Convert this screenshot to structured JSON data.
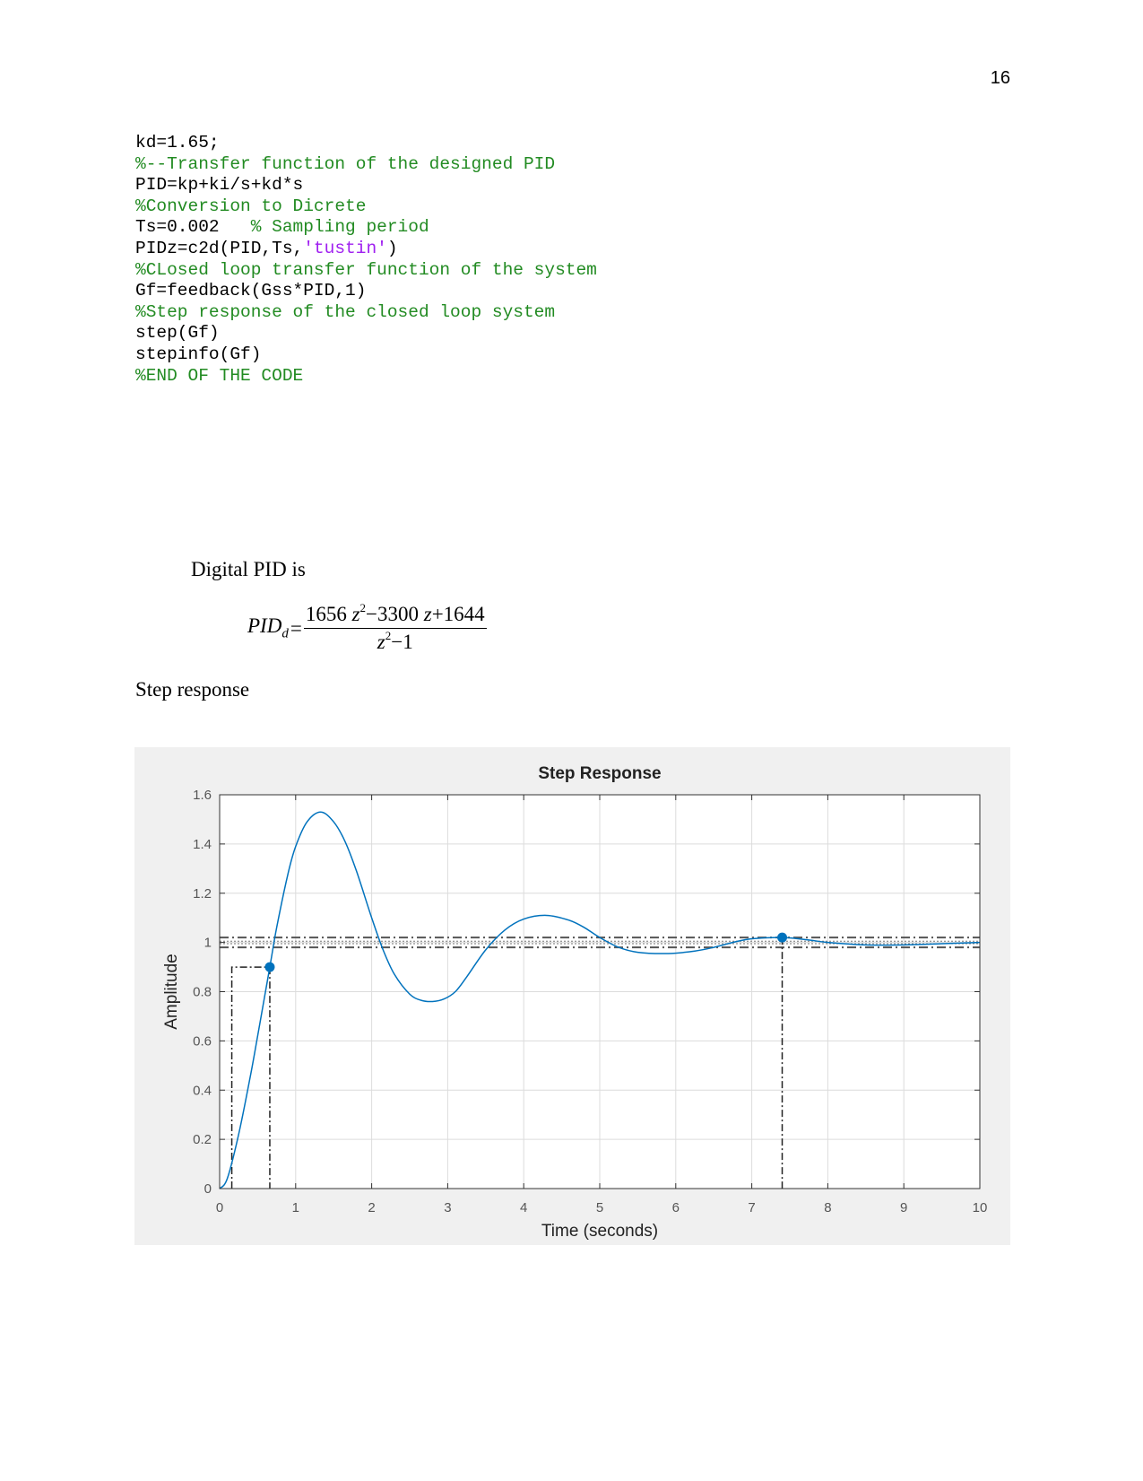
{
  "page_number": "16",
  "code_lines": [
    [
      {
        "t": "kd=1.65;",
        "k": "code"
      }
    ],
    [
      {
        "t": "%--Transfer function of the designed PID",
        "k": "comment"
      }
    ],
    [
      {
        "t": "PID=kp+ki/s+kd*s",
        "k": "code"
      }
    ],
    [
      {
        "t": "%Conversion to Dicrete",
        "k": "comment"
      }
    ],
    [
      {
        "t": "Ts=0.002   ",
        "k": "code"
      },
      {
        "t": "% Sampling period",
        "k": "comment"
      }
    ],
    [
      {
        "t": "PIDz=c2d(PID,Ts,",
        "k": "code"
      },
      {
        "t": "'tustin'",
        "k": "string"
      },
      {
        "t": ")",
        "k": "code"
      }
    ],
    [
      {
        "t": "%CLosed loop transfer function of the system",
        "k": "comment"
      }
    ],
    [
      {
        "t": "Gf=feedback(Gss*PID,1)",
        "k": "code"
      }
    ],
    [
      {
        "t": "%Step response of the closed loop system",
        "k": "comment"
      }
    ],
    [
      {
        "t": "step(Gf)",
        "k": "code"
      }
    ],
    [
      {
        "t": "stepinfo(Gf)",
        "k": "code"
      }
    ],
    [
      {
        "t": "%END OF THE CODE",
        "k": "comment"
      }
    ]
  ],
  "colors": {
    "comment": "#228b22",
    "string": "#a020f0",
    "code": "#000000",
    "curve": "#0072bd",
    "chart_bg": "#f0f0f0"
  },
  "digital_pid_label": "Digital PID is",
  "equation": {
    "lhs": "PID",
    "lhs_sub": "d",
    "equals": "=",
    "num_a": "1656",
    "num_b": "−3300",
    "num_c": "+1644",
    "den_b": "−1",
    "var": "z",
    "exp": "2"
  },
  "step_response_label": "Step response",
  "chart_data": {
    "type": "line",
    "title": "Step Response",
    "xlabel": "Time (seconds)",
    "ylabel": "Amplitude",
    "xlim": [
      0,
      10
    ],
    "ylim": [
      0,
      1.6
    ],
    "xticks": [
      "0",
      "1",
      "2",
      "3",
      "4",
      "5",
      "6",
      "7",
      "8",
      "9",
      "10"
    ],
    "yticks": [
      "0",
      "0.2",
      "0.4",
      "0.6",
      "0.8",
      "1",
      "1.2",
      "1.4",
      "1.6"
    ],
    "grid": true,
    "x": [
      0,
      0.1,
      0.25,
      0.4,
      0.5,
      0.66,
      0.75,
      0.9,
      1.0,
      1.15,
      1.33,
      1.5,
      1.65,
      1.8,
      2.0,
      2.15,
      2.3,
      2.5,
      2.65,
      2.8,
      2.95,
      3.1,
      3.25,
      3.5,
      3.75,
      4.0,
      4.3,
      4.6,
      4.8,
      5.0,
      5.25,
      5.5,
      5.9,
      6.25,
      6.5,
      6.75,
      7.0,
      7.4,
      7.75,
      8.0,
      8.5,
      9.0,
      9.5,
      10
    ],
    "y": [
      0,
      0.04,
      0.22,
      0.45,
      0.62,
      0.9,
      1.06,
      1.28,
      1.39,
      1.49,
      1.53,
      1.49,
      1.41,
      1.29,
      1.1,
      0.97,
      0.87,
      0.79,
      0.765,
      0.76,
      0.77,
      0.8,
      0.86,
      0.97,
      1.05,
      1.095,
      1.11,
      1.09,
      1.06,
      1.02,
      0.98,
      0.96,
      0.955,
      0.965,
      0.98,
      1.0,
      1.015,
      1.02,
      1.01,
      1.0,
      0.99,
      0.99,
      0.995,
      1.0
    ],
    "markers": [
      {
        "label": "rise time",
        "x": 0.66,
        "y": 0.9
      },
      {
        "label": "settling time",
        "x": 7.4,
        "y": 1.02
      }
    ],
    "rise_start": {
      "x": 0.16,
      "y": 0.1
    },
    "settling_band": [
      0.98,
      1.02
    ],
    "steady_state": [
      0.995,
      1.005
    ]
  }
}
